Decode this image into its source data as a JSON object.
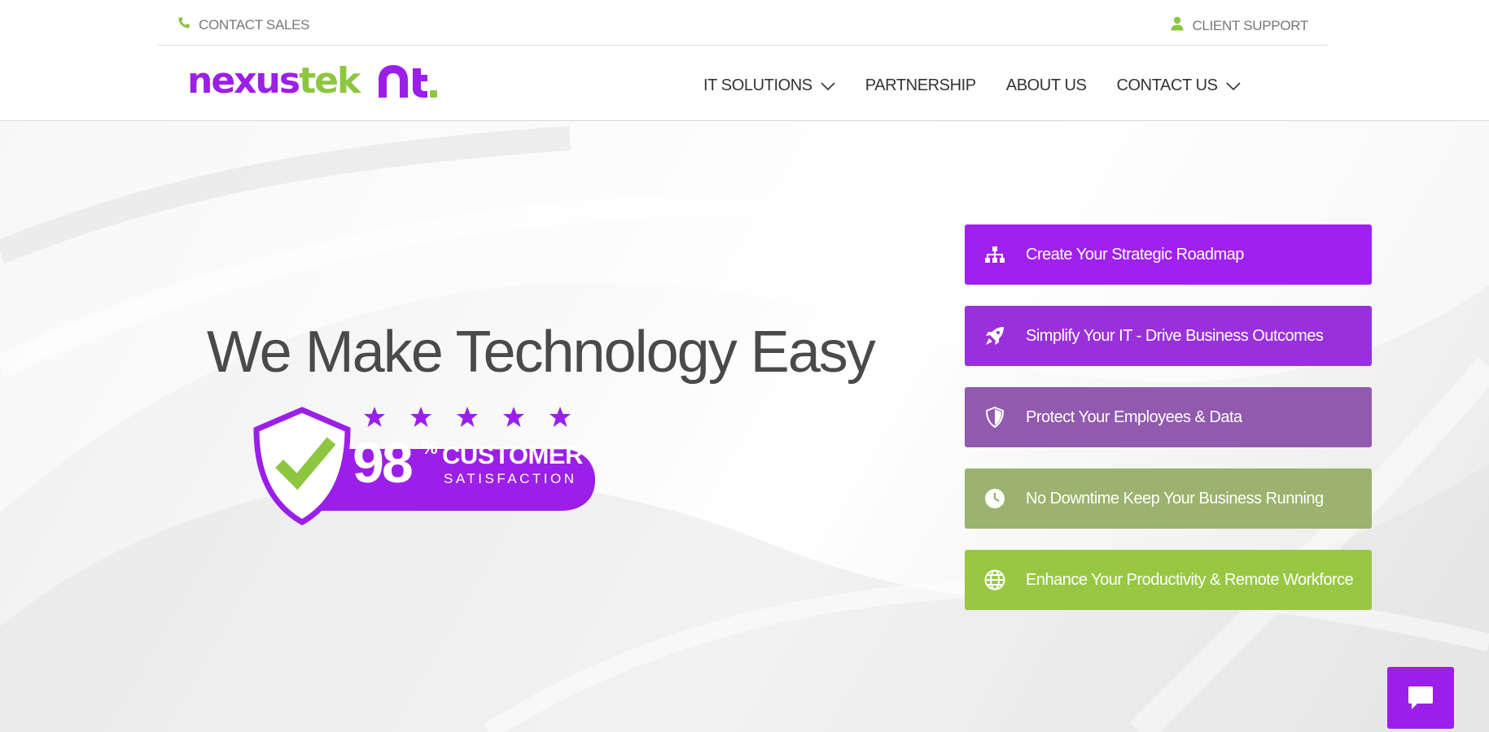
{
  "topbar": {
    "contact_sales": "CONTACT SALES",
    "client_support": "CLIENT SUPPORT",
    "icon_color": "#8dc63f"
  },
  "header": {
    "logo": {
      "word_primary": "nexus",
      "word_secondary": "tek",
      "mark": "nt."
    },
    "nav": [
      {
        "label": "IT SOLUTIONS",
        "has_dropdown": true
      },
      {
        "label": "PARTNERSHIP",
        "has_dropdown": false
      },
      {
        "label": "ABOUT US",
        "has_dropdown": false
      },
      {
        "label": "CONTACT US",
        "has_dropdown": true
      }
    ]
  },
  "hero": {
    "headline": "We Make Technology Easy",
    "badge": {
      "value": "98",
      "symbol": "%",
      "line1": "CUSTOMER",
      "line2": "SATISFACTION",
      "stars": 5
    },
    "ctas": [
      {
        "label": "Create Your Strategic Roadmap",
        "icon": "sitemap-icon",
        "color": "#a020f0"
      },
      {
        "label": "Simplify Your IT - Drive Business Outcomes",
        "icon": "rocket-icon",
        "color": "#9a30dc"
      },
      {
        "label": "Protect Your Employees & Data",
        "icon": "shield-icon",
        "color": "#915aae"
      },
      {
        "label": "No Downtime Keep Your Business Running",
        "icon": "clock-icon",
        "color": "#9bb36e"
      },
      {
        "label": "Enhance Your Productivity & Remote Workforce",
        "icon": "globe-icon",
        "color": "#98c843"
      }
    ]
  },
  "colors": {
    "brand_purple": "#9b1fe8",
    "brand_green": "#8dc63f"
  },
  "chat": {
    "icon": "chat-bubble-icon"
  }
}
